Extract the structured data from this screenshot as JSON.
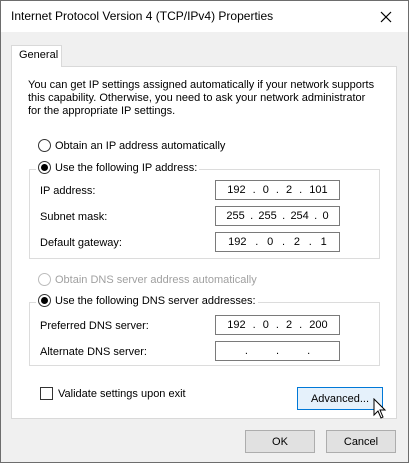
{
  "window": {
    "title": "Internet Protocol Version 4 (TCP/IPv4) Properties",
    "close_icon": "close-icon"
  },
  "tabs": [
    {
      "label": "General"
    }
  ],
  "description": "You can get IP settings assigned automatically if your network supports this capability. Otherwise, you need to ask your network administrator for the appropriate IP settings.",
  "ip_mode": {
    "auto_label": "Obtain an IP address automatically",
    "manual_label": "Use the following IP address:",
    "selected": "manual"
  },
  "ip_fields": {
    "ip_address": {
      "label": "IP address:",
      "octets": [
        "192",
        "0",
        "2",
        "101"
      ]
    },
    "subnet_mask": {
      "label": "Subnet mask:",
      "octets": [
        "255",
        "255",
        "254",
        "0"
      ]
    },
    "default_gateway": {
      "label": "Default gateway:",
      "octets": [
        "192",
        "0",
        "2",
        "1"
      ]
    }
  },
  "dns_mode": {
    "auto_label": "Obtain DNS server address automatically",
    "manual_label": "Use the following DNS server addresses:",
    "selected": "manual",
    "auto_enabled": false
  },
  "dns_fields": {
    "preferred": {
      "label": "Preferred DNS server:",
      "octets": [
        "192",
        "0",
        "2",
        "200"
      ]
    },
    "alternate": {
      "label": "Alternate DNS server:",
      "octets": [
        "",
        "",
        "",
        ""
      ]
    }
  },
  "validate": {
    "label": "Validate settings upon exit",
    "checked": false
  },
  "buttons": {
    "advanced": "Advanced...",
    "ok": "OK",
    "cancel": "Cancel"
  },
  "colors": {
    "focus_border": "#0078d7",
    "window_bg": "#f0f0f0",
    "disabled_text": "#a0a0a0"
  }
}
